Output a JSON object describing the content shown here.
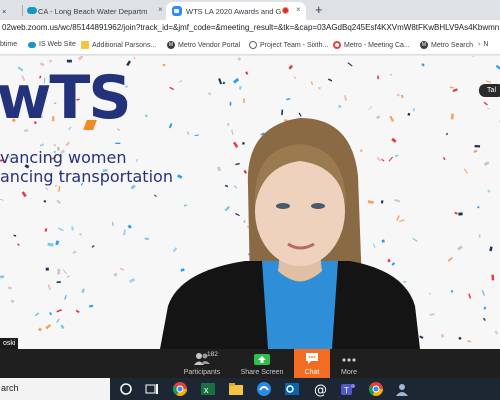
{
  "browser": {
    "tabs": [
      {
        "label": "x"
      },
      {
        "label": "CA - Long Beach Water Departm",
        "icon": "salesforce-cloud-icon"
      },
      {
        "label": "WTS LA 2020 Awards and G",
        "icon": "zoom-icon",
        "active": true
      }
    ],
    "tab_close_glyph": "×",
    "new_tab_glyph": "+",
    "address": "02web.zoom.us/wc/85144891962/join?track_id=&jmf_code=&meeting_result=&tk=&cap=03AGdBq245Esf4KXVmW8tFKwBHLV9As4Kbwmn...",
    "bookmarks": [
      {
        "label": "btime",
        "icon": "none"
      },
      {
        "label": "IS Web Site",
        "icon": "salesforce-cloud-icon"
      },
      {
        "label": "Additional Parsons...",
        "icon": "folder-icon"
      },
      {
        "label": "Metro Vendor Portal",
        "icon": "metro-m-icon"
      },
      {
        "label": "Project Team - Sixth...",
        "icon": "globe-icon"
      },
      {
        "label": "Metro - Meeting Ca...",
        "icon": "google-g-icon"
      },
      {
        "label": "Metro Search",
        "icon": "metro-m-icon"
      },
      {
        "label": "N",
        "icon": "metro-m-icon"
      }
    ]
  },
  "meeting": {
    "logo_text": "wTS",
    "tagline_1": "vancing women",
    "tagline_2": "ancing transportation",
    "active_speaker_label": "Tal",
    "participant_name": "oski"
  },
  "controls": {
    "participants_label": "Participants",
    "participants_count": "182",
    "share_label": "Share Screen",
    "chat_label": "Chat",
    "more_label": "More"
  },
  "taskbar": {
    "search_placeholder": "arch",
    "apps": [
      "task-view-icon",
      "chrome-icon",
      "excel-icon",
      "file-explorer-icon",
      "edge-icon",
      "outlook-icon",
      "at-sign-icon",
      "teams-icon",
      "chrome-icon",
      "people-icon"
    ]
  },
  "colors": {
    "brand_navy": "#23327a",
    "brand_orange": "#f08a24",
    "zoom_bar": "#1f1f1f",
    "chat_accent": "#f26d21",
    "share_green": "#2fbf4f"
  }
}
